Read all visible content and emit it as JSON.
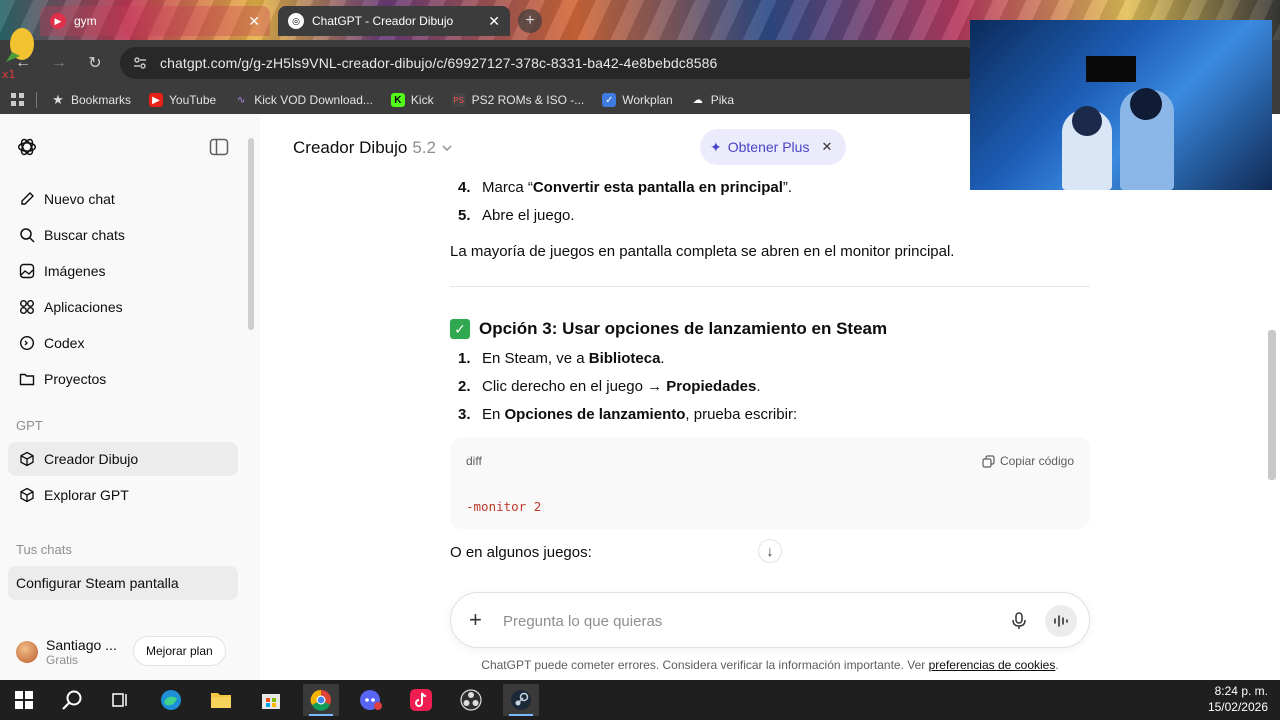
{
  "browser": {
    "tabs": [
      {
        "label": "gym",
        "active": false
      },
      {
        "label": "ChatGPT - Creador Dibujo",
        "active": true
      }
    ],
    "url": "chatgpt.com/g/g-zH5ls9VNL-creador-dibujo/c/69927127-378c-8331-ba42-4e8bebdc8586",
    "bookmarks": [
      "Bookmarks",
      "YouTube",
      "Kick VOD Download...",
      "Kick",
      "PS2 ROMs & ISO -...",
      "Workplan",
      "Pika"
    ]
  },
  "sidebar": {
    "items": [
      {
        "label": "Nuevo chat",
        "icon": "edit-icon"
      },
      {
        "label": "Buscar chats",
        "icon": "search-icon"
      },
      {
        "label": "Imágenes",
        "icon": "image-icon"
      },
      {
        "label": "Aplicaciones",
        "icon": "apps-icon"
      },
      {
        "label": "Codex",
        "icon": "codex-icon"
      },
      {
        "label": "Proyectos",
        "icon": "folder-icon"
      }
    ],
    "gpt_section": "GPT",
    "gpts": [
      {
        "label": "Creador Dibujo"
      },
      {
        "label": "Explorar GPT"
      }
    ],
    "chats_section": "Tus chats",
    "chats": [
      {
        "label": "Configurar Steam pantalla"
      }
    ],
    "user": {
      "name": "Santiago ...",
      "plan": "Gratis",
      "upgrade": "Mejorar plan"
    }
  },
  "header": {
    "model": "Creador Dibujo",
    "version": "5.2",
    "obtain_plus": "Obtener Plus"
  },
  "conversation": {
    "step4_prefix": "Marca “",
    "step4_bold": "Convertir esta pantalla en principal",
    "step4_suffix": "”.",
    "step5": "Abre el juego.",
    "paragraph1": "La mayoría de juegos en pantalla completa se abren en el monitor principal.",
    "option3_title": "Opción 3: Usar opciones de lanzamiento en Steam",
    "steps": [
      {
        "num": "1.",
        "pre": "En Steam, ve a ",
        "bold": "Biblioteca",
        "post": "."
      },
      {
        "num": "2.",
        "pre": "Clic derecho en el juego → ",
        "bold": "Propiedades",
        "post": "."
      },
      {
        "num": "3.",
        "pre": "En ",
        "bold": "Opciones de lanzamiento",
        "post": ", prueba escribir:"
      }
    ],
    "code_lang": "diff",
    "copy_label": "Copiar código",
    "code": "-monitor 2",
    "paragraph2": "O en algunos juegos:"
  },
  "composer": {
    "placeholder": "Pregunta lo que quieras"
  },
  "disclaimer": {
    "text": "ChatGPT puede cometer errores. Considera verificar la información importante. Ver ",
    "link": "preferencias de cookies",
    "end": "."
  },
  "taskbar": {
    "time": "8:24 p. m.",
    "date": "15/02/2026"
  }
}
